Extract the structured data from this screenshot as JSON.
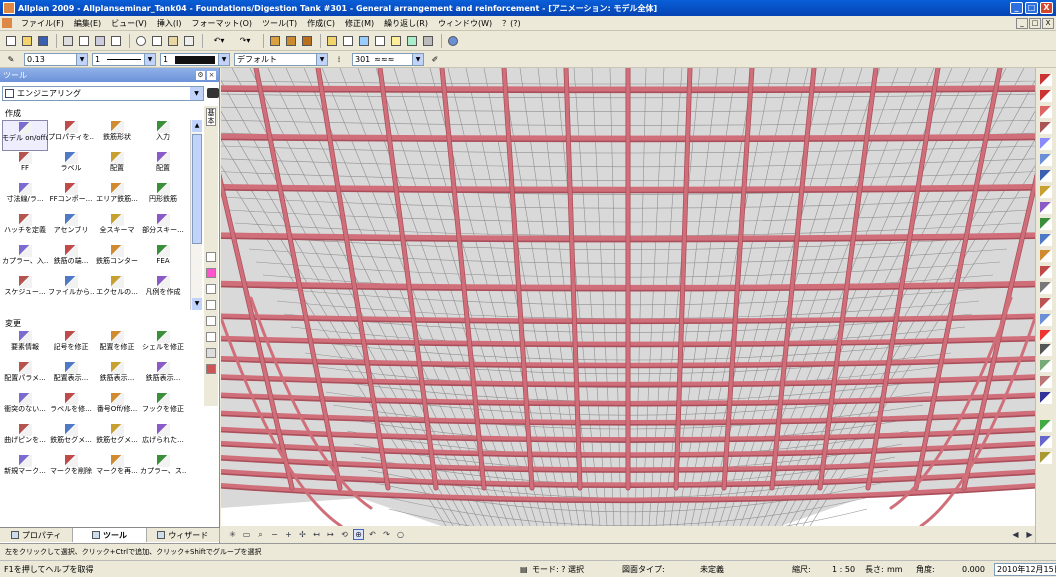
{
  "window": {
    "title": "Allplan 2009 - Allplanseminar_Tank04 - Foundations/Digestion Tank #301 - General arrangement and reinforcement - [アニメーション: モデル全体]",
    "buttons": [
      "_",
      "□",
      "X"
    ]
  },
  "menu": {
    "items": [
      "ファイル(F)",
      "編集(E)",
      "ビュー(V)",
      "挿入(I)",
      "フォーマット(O)",
      "ツール(T)",
      "作成(C)",
      "修正(M)",
      "繰り返し(R)",
      "ウィンドウ(W)",
      "？(?)"
    ],
    "mdi_buttons": [
      "_",
      "□",
      "X"
    ]
  },
  "format_bar": {
    "pen": "0.13",
    "line": "1",
    "color": "1",
    "layer": "デフォルト",
    "pattern": "301"
  },
  "tools_panel": {
    "title": "ツール",
    "module": "エンジニアリング",
    "side_tab": "基本",
    "sections": [
      {
        "label": "作成",
        "tools": [
          "モデル\non/offの鉄...",
          "プロパティを...",
          "鉄筋形状",
          "入力",
          "FF",
          "ラベル",
          "配置",
          "配置",
          "寸法線/ラ...",
          "FFコンポー...",
          "エリア鉄筋...",
          "円形鉄筋",
          "ハッチを定義",
          "アセンブリ",
          "全スキーマ",
          "部分スキー...",
          "カプラー、入...",
          "鉄筋の端...",
          "鉄筋コンター",
          "FEA",
          "スケジュー...",
          "ファイルから...",
          "エクセルの...",
          "凡例を作成"
        ]
      },
      {
        "label": "変更",
        "tools": [
          "要素情報",
          "記号を修正",
          "配置を修正",
          "シェルを修正",
          "配置パラメ...",
          "配置表示...",
          "鉄筋表示...",
          "鉄筋表示...",
          "衝突のない...",
          "ラベルを修...",
          "番号Off/修...",
          "フックを修正",
          "曲げピンを...",
          "鉄筋セグメ...",
          "鉄筋セグメ...",
          "広げられた...",
          "新規マーク...",
          "マークを削除",
          "マークを再...",
          "カプラー、ス..."
        ]
      }
    ],
    "tabs": [
      "プロパティ",
      "ツール",
      "ウィザード"
    ]
  },
  "hint": "左をクリックして選択、クリック+Ctrlで追加、クリック+Shiftでグループを選択",
  "status": {
    "help": "F1を押してヘルプを取得",
    "mode": "モード: ? 選択",
    "drawing_type": "図面タイプ:",
    "drawing_type_value": "未定義",
    "scale_label": "縮尺:",
    "scale_value": "1 : 50",
    "length_label": "長さ:",
    "length_unit": "mm",
    "angle_label": "角度:",
    "angle_value": "0.000",
    "date": "2010年12月15日"
  },
  "colors": {
    "rebar": "#d06f7a",
    "rebar_dark": "#a94f5b",
    "mesh": "#8f8f8f",
    "background": "#ffffff"
  }
}
